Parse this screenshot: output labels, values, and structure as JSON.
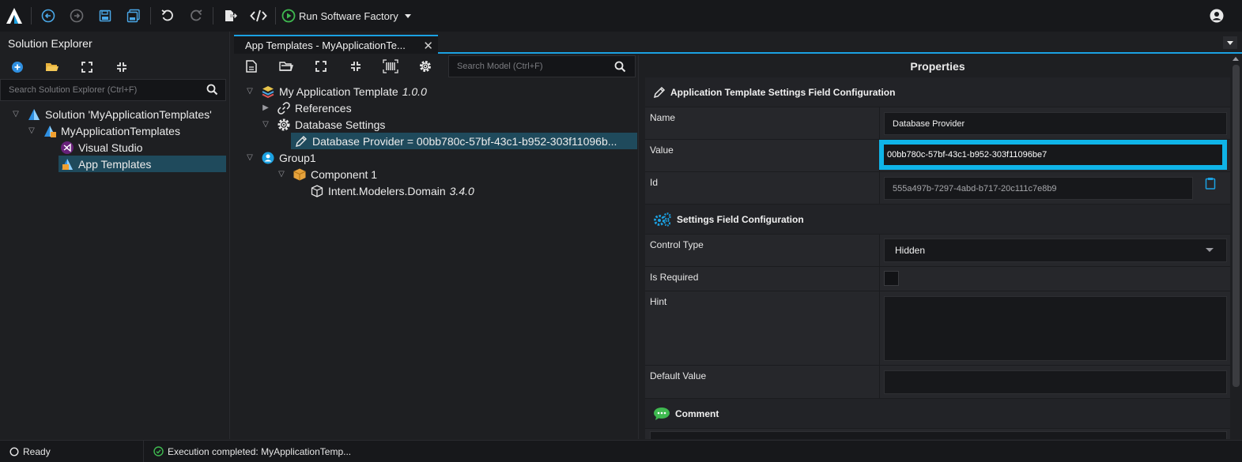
{
  "toolbar": {
    "run_label": "Run Software Factory",
    "icons": [
      "intent-logo-icon",
      "back-icon",
      "forward-icon",
      "save-icon",
      "save-all-icon",
      "undo-icon",
      "redo-icon",
      "export-icon",
      "code-icon",
      "play-icon",
      "dropdown-caret-icon",
      "user-icon"
    ]
  },
  "solution_explorer": {
    "title": "Solution Explorer",
    "search_placeholder": "Search Solution Explorer (Ctrl+F)",
    "items": [
      {
        "label": "Solution 'MyApplicationTemplates'"
      },
      {
        "label": "MyApplicationTemplates"
      },
      {
        "label": "Visual Studio"
      },
      {
        "label": "App Templates"
      }
    ]
  },
  "tabs": {
    "active_label": "App Templates - MyApplicationTe...",
    "close_symbol": "✕"
  },
  "model": {
    "search_placeholder": "Search Model (Ctrl+F)",
    "tree": [
      {
        "label": "My Application Template",
        "version": "1.0.0"
      },
      {
        "label": "References"
      },
      {
        "label": "Database Settings"
      },
      {
        "label": "Database Provider = 00bb780c-57bf-43c1-b952-303f11096b..."
      },
      {
        "label": "Group1"
      },
      {
        "label": "Component 1"
      },
      {
        "label": "Intent.Modelers.Domain",
        "version": "3.4.0"
      }
    ]
  },
  "properties": {
    "title": "Properties",
    "section1": "Application Template Settings Field Configuration",
    "name_label": "Name",
    "name_value": "Database Provider",
    "value_label": "Value",
    "value_value": "00bb780c-57bf-43c1-b952-303f11096be7",
    "id_label": "Id",
    "id_value": "555a497b-7297-4abd-b717-20c111c7e8b9",
    "section2": "Settings Field Configuration",
    "control_type_label": "Control Type",
    "control_type_value": "Hidden",
    "is_required_label": "Is Required",
    "is_required_checked": false,
    "hint_label": "Hint",
    "hint_value": "",
    "default_value_label": "Default Value",
    "default_value_value": "",
    "section3": "Comment"
  },
  "status": {
    "ready": "Ready",
    "execution": "Execution completed: MyApplicationTemp..."
  },
  "colors": {
    "accent": "#1ba1e2",
    "focus_border": "#0fb4e8",
    "selection": "#1f4a5c",
    "run_green": "#3fb950"
  }
}
